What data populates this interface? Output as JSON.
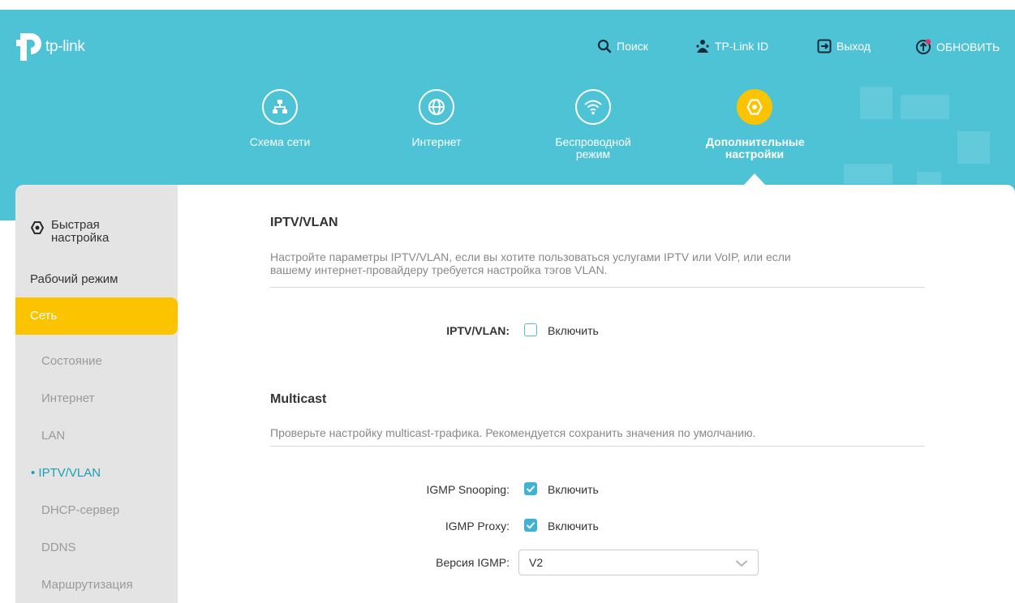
{
  "brand": {
    "name": "tp-link"
  },
  "topnav": {
    "search": "Поиск",
    "tplink_id": "TP-Link ID",
    "logout": "Выход",
    "update": "ОБНОВИТЬ"
  },
  "tabs": [
    {
      "label_line1": "Схема сети",
      "label_line2": ""
    },
    {
      "label_line1": "Интернет",
      "label_line2": ""
    },
    {
      "label_line1": "Беспроводной",
      "label_line2": "режим"
    },
    {
      "label_line1": "Дополнительные",
      "label_line2": "настройки"
    }
  ],
  "sidebar": {
    "quick_setup_line1": "Быстрая",
    "quick_setup_line2": "настройка",
    "work_mode": "Рабочий режим",
    "network": "Сеть",
    "sub": [
      {
        "label": "Состояние"
      },
      {
        "label": "Интернет"
      },
      {
        "label": "LAN"
      },
      {
        "label": "• IPTV/VLAN"
      },
      {
        "label": "DHCP-сервер"
      },
      {
        "label": "DDNS"
      },
      {
        "label": "Маршрутизация"
      }
    ]
  },
  "iptv": {
    "title": "IPTV/VLAN",
    "desc_line1": "Настройте параметры IPTV/VLAN, если вы хотите пользоваться услугами IPTV или VoIP, или если",
    "desc_line2": "вашему интернет-провайдеру требуется настройка тэгов VLAN.",
    "field_label": "IPTV/VLAN:",
    "enable_label": "Включить",
    "enabled": false
  },
  "multicast": {
    "title": "Multicast",
    "desc": "Проверьте настройку multicast-трафика. Рекомендуется сохранить значения по умолчанию.",
    "snooping_label": "IGMP Snooping:",
    "snooping_enable": "Включить",
    "snooping_checked": true,
    "proxy_label": "IGMP Proxy:",
    "proxy_enable": "Включить",
    "proxy_checked": true,
    "version_label": "Версия IGMP:",
    "version_value": "V2"
  },
  "colors": {
    "header": "#4ec3d6",
    "accent": "#fcc400",
    "checkbox": "#3fb3d1",
    "sidebar": "#e4e4e4"
  }
}
